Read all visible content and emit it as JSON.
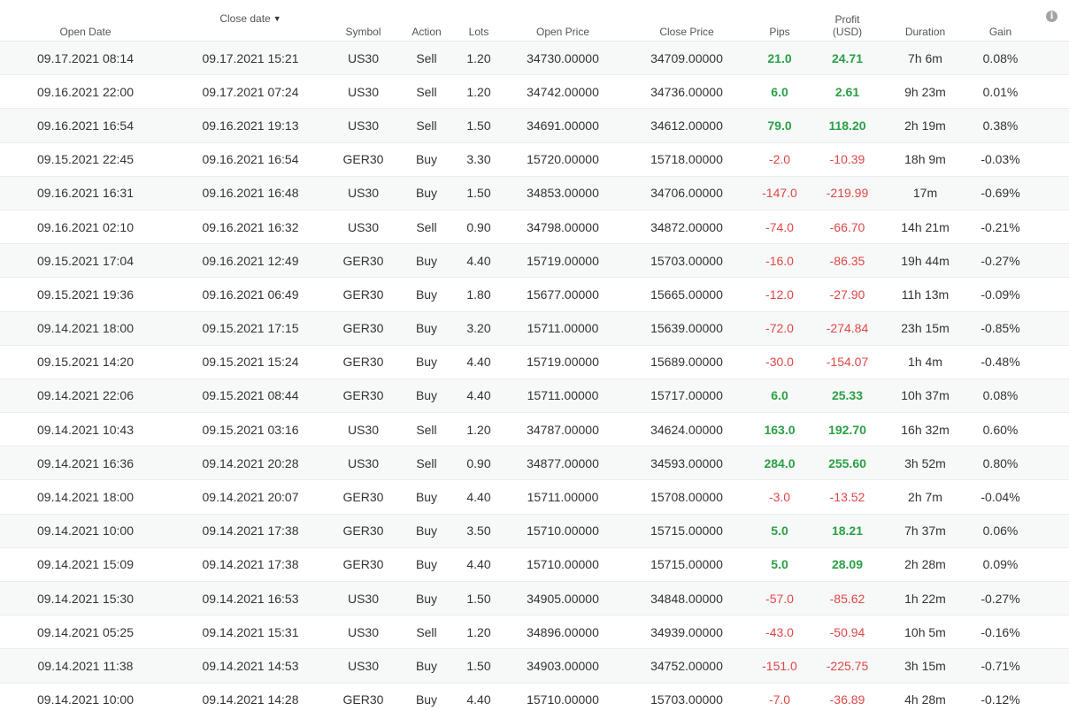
{
  "header": {
    "open_date": "Open Date",
    "close_date": "Close date",
    "sort_arrow": "▼",
    "symbol": "Symbol",
    "action": "Action",
    "lots": "Lots",
    "open_price": "Open Price",
    "close_price": "Close Price",
    "pips": "Pips",
    "profit_line1": "Profit",
    "profit_line2": "(USD)",
    "duration": "Duration",
    "gain": "Gain",
    "info_icon": "i"
  },
  "colors": {
    "positive": "#2aa046",
    "negative": "#e04646",
    "row_alt": "#f7f9f8"
  },
  "rows": [
    {
      "open_date": "09.17.2021 08:14",
      "close_date": "09.17.2021 15:21",
      "symbol": "US30",
      "action": "Sell",
      "lots": "1.20",
      "open_price": "34730.00000",
      "close_price": "34709.00000",
      "pips": "21.0",
      "profit": "24.71",
      "duration": "7h 6m",
      "gain": "0.08%",
      "sign": "pos"
    },
    {
      "open_date": "09.16.2021 22:00",
      "close_date": "09.17.2021 07:24",
      "symbol": "US30",
      "action": "Sell",
      "lots": "1.20",
      "open_price": "34742.00000",
      "close_price": "34736.00000",
      "pips": "6.0",
      "profit": "2.61",
      "duration": "9h 23m",
      "gain": "0.01%",
      "sign": "pos"
    },
    {
      "open_date": "09.16.2021 16:54",
      "close_date": "09.16.2021 19:13",
      "symbol": "US30",
      "action": "Sell",
      "lots": "1.50",
      "open_price": "34691.00000",
      "close_price": "34612.00000",
      "pips": "79.0",
      "profit": "118.20",
      "duration": "2h 19m",
      "gain": "0.38%",
      "sign": "pos"
    },
    {
      "open_date": "09.15.2021 22:45",
      "close_date": "09.16.2021 16:54",
      "symbol": "GER30",
      "action": "Buy",
      "lots": "3.30",
      "open_price": "15720.00000",
      "close_price": "15718.00000",
      "pips": "-2.0",
      "profit": "-10.39",
      "duration": "18h 9m",
      "gain": "-0.03%",
      "sign": "neg"
    },
    {
      "open_date": "09.16.2021 16:31",
      "close_date": "09.16.2021 16:48",
      "symbol": "US30",
      "action": "Buy",
      "lots": "1.50",
      "open_price": "34853.00000",
      "close_price": "34706.00000",
      "pips": "-147.0",
      "profit": "-219.99",
      "duration": "17m",
      "gain": "-0.69%",
      "sign": "neg"
    },
    {
      "open_date": "09.16.2021 02:10",
      "close_date": "09.16.2021 16:32",
      "symbol": "US30",
      "action": "Sell",
      "lots": "0.90",
      "open_price": "34798.00000",
      "close_price": "34872.00000",
      "pips": "-74.0",
      "profit": "-66.70",
      "duration": "14h 21m",
      "gain": "-0.21%",
      "sign": "neg"
    },
    {
      "open_date": "09.15.2021 17:04",
      "close_date": "09.16.2021 12:49",
      "symbol": "GER30",
      "action": "Buy",
      "lots": "4.40",
      "open_price": "15719.00000",
      "close_price": "15703.00000",
      "pips": "-16.0",
      "profit": "-86.35",
      "duration": "19h 44m",
      "gain": "-0.27%",
      "sign": "neg"
    },
    {
      "open_date": "09.15.2021 19:36",
      "close_date": "09.16.2021 06:49",
      "symbol": "GER30",
      "action": "Buy",
      "lots": "1.80",
      "open_price": "15677.00000",
      "close_price": "15665.00000",
      "pips": "-12.0",
      "profit": "-27.90",
      "duration": "11h 13m",
      "gain": "-0.09%",
      "sign": "neg"
    },
    {
      "open_date": "09.14.2021 18:00",
      "close_date": "09.15.2021 17:15",
      "symbol": "GER30",
      "action": "Buy",
      "lots": "3.20",
      "open_price": "15711.00000",
      "close_price": "15639.00000",
      "pips": "-72.0",
      "profit": "-274.84",
      "duration": "23h 15m",
      "gain": "-0.85%",
      "sign": "neg"
    },
    {
      "open_date": "09.15.2021 14:20",
      "close_date": "09.15.2021 15:24",
      "symbol": "GER30",
      "action": "Buy",
      "lots": "4.40",
      "open_price": "15719.00000",
      "close_price": "15689.00000",
      "pips": "-30.0",
      "profit": "-154.07",
      "duration": "1h 4m",
      "gain": "-0.48%",
      "sign": "neg"
    },
    {
      "open_date": "09.14.2021 22:06",
      "close_date": "09.15.2021 08:44",
      "symbol": "GER30",
      "action": "Buy",
      "lots": "4.40",
      "open_price": "15711.00000",
      "close_price": "15717.00000",
      "pips": "6.0",
      "profit": "25.33",
      "duration": "10h 37m",
      "gain": "0.08%",
      "sign": "pos"
    },
    {
      "open_date": "09.14.2021 10:43",
      "close_date": "09.15.2021 03:16",
      "symbol": "US30",
      "action": "Sell",
      "lots": "1.20",
      "open_price": "34787.00000",
      "close_price": "34624.00000",
      "pips": "163.0",
      "profit": "192.70",
      "duration": "16h 32m",
      "gain": "0.60%",
      "sign": "pos"
    },
    {
      "open_date": "09.14.2021 16:36",
      "close_date": "09.14.2021 20:28",
      "symbol": "US30",
      "action": "Sell",
      "lots": "0.90",
      "open_price": "34877.00000",
      "close_price": "34593.00000",
      "pips": "284.0",
      "profit": "255.60",
      "duration": "3h 52m",
      "gain": "0.80%",
      "sign": "pos"
    },
    {
      "open_date": "09.14.2021 18:00",
      "close_date": "09.14.2021 20:07",
      "symbol": "GER30",
      "action": "Buy",
      "lots": "4.40",
      "open_price": "15711.00000",
      "close_price": "15708.00000",
      "pips": "-3.0",
      "profit": "-13.52",
      "duration": "2h 7m",
      "gain": "-0.04%",
      "sign": "neg"
    },
    {
      "open_date": "09.14.2021 10:00",
      "close_date": "09.14.2021 17:38",
      "symbol": "GER30",
      "action": "Buy",
      "lots": "3.50",
      "open_price": "15710.00000",
      "close_price": "15715.00000",
      "pips": "5.0",
      "profit": "18.21",
      "duration": "7h 37m",
      "gain": "0.06%",
      "sign": "pos"
    },
    {
      "open_date": "09.14.2021 15:09",
      "close_date": "09.14.2021 17:38",
      "symbol": "GER30",
      "action": "Buy",
      "lots": "4.40",
      "open_price": "15710.00000",
      "close_price": "15715.00000",
      "pips": "5.0",
      "profit": "28.09",
      "duration": "2h 28m",
      "gain": "0.09%",
      "sign": "pos"
    },
    {
      "open_date": "09.14.2021 15:30",
      "close_date": "09.14.2021 16:53",
      "symbol": "US30",
      "action": "Buy",
      "lots": "1.50",
      "open_price": "34905.00000",
      "close_price": "34848.00000",
      "pips": "-57.0",
      "profit": "-85.62",
      "duration": "1h 22m",
      "gain": "-0.27%",
      "sign": "neg"
    },
    {
      "open_date": "09.14.2021 05:25",
      "close_date": "09.14.2021 15:31",
      "symbol": "US30",
      "action": "Sell",
      "lots": "1.20",
      "open_price": "34896.00000",
      "close_price": "34939.00000",
      "pips": "-43.0",
      "profit": "-50.94",
      "duration": "10h 5m",
      "gain": "-0.16%",
      "sign": "neg"
    },
    {
      "open_date": "09.14.2021 11:38",
      "close_date": "09.14.2021 14:53",
      "symbol": "US30",
      "action": "Buy",
      "lots": "1.50",
      "open_price": "34903.00000",
      "close_price": "34752.00000",
      "pips": "-151.0",
      "profit": "-225.75",
      "duration": "3h 15m",
      "gain": "-0.71%",
      "sign": "neg"
    },
    {
      "open_date": "09.14.2021 10:00",
      "close_date": "09.14.2021 14:28",
      "symbol": "GER30",
      "action": "Buy",
      "lots": "4.40",
      "open_price": "15710.00000",
      "close_price": "15703.00000",
      "pips": "-7.0",
      "profit": "-36.89",
      "duration": "4h 28m",
      "gain": "-0.12%",
      "sign": "neg"
    }
  ]
}
